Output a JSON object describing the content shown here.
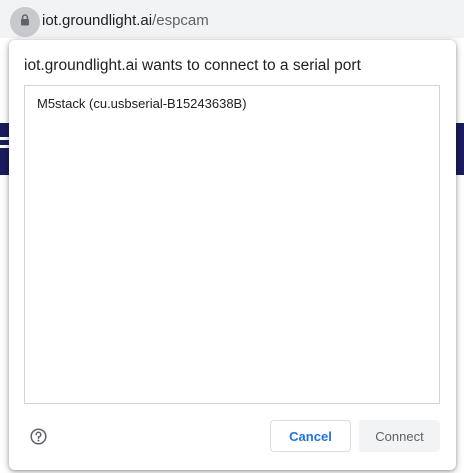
{
  "browser": {
    "url_host": "iot.groundlight.ai",
    "url_path": "/espcam",
    "lock_icon": "lock-icon"
  },
  "dialog": {
    "title": "iot.groundlight.ai wants to connect to a serial port",
    "ports": [
      {
        "label": "M5stack (cu.usbserial-B15243638B)"
      }
    ],
    "help_icon": "help-circle-icon",
    "cancel_label": "Cancel",
    "connect_label": "Connect"
  },
  "colors": {
    "accent": "#1a73e8",
    "page_band": "#1b1b5e"
  }
}
